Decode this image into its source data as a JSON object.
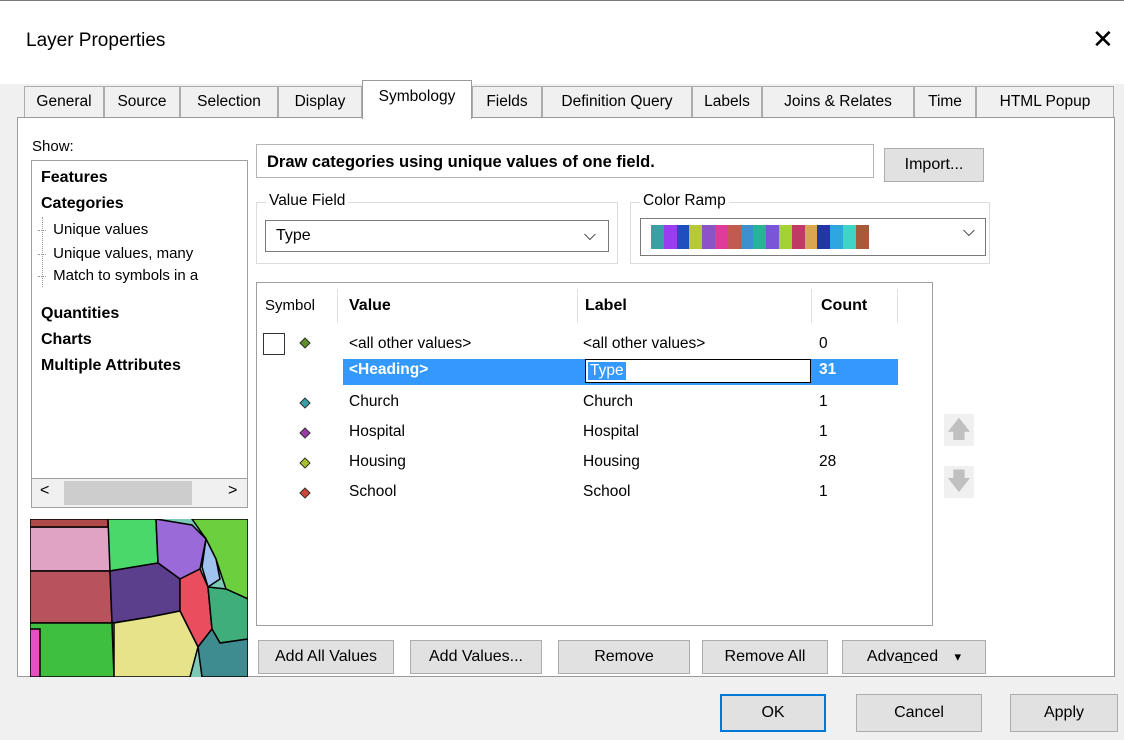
{
  "window": {
    "title": "Layer Properties",
    "close": "✕"
  },
  "tabs": [
    {
      "label": "General",
      "active": false
    },
    {
      "label": "Source",
      "active": false
    },
    {
      "label": "Selection",
      "active": false
    },
    {
      "label": "Display",
      "active": false
    },
    {
      "label": "Symbology",
      "active": true
    },
    {
      "label": "Fields",
      "active": false
    },
    {
      "label": "Definition Query",
      "active": false
    },
    {
      "label": "Labels",
      "active": false
    },
    {
      "label": "Joins & Relates",
      "active": false
    },
    {
      "label": "Time",
      "active": false
    },
    {
      "label": "HTML Popup",
      "active": false
    }
  ],
  "show": {
    "label": "Show:",
    "items": [
      "Features",
      "Categories",
      "Quantities",
      "Charts",
      "Multiple Attributes"
    ],
    "sub_items": [
      "Unique values",
      "Unique values, many",
      "Match to symbols in a"
    ],
    "scroll_left": "<",
    "scroll_right": ">"
  },
  "description": "Draw categories using unique values of one field.",
  "import_button": "Import...",
  "value_field": {
    "label": "Value Field",
    "value": "Type",
    "chevron": "⌵"
  },
  "color_ramp": {
    "label": "Color Ramp",
    "colors": [
      "#3aa0a4",
      "#9a3df0",
      "#1f4fbf",
      "#b7c934",
      "#8d52c8",
      "#e03a9a",
      "#c25a4f",
      "#3e8fcf",
      "#27b399",
      "#7a55d8",
      "#a4d233",
      "#c03b63",
      "#d8a74f",
      "#2137a7",
      "#2ea6e0",
      "#3fd4c6",
      "#a75a3a"
    ]
  },
  "table": {
    "headers": {
      "symbol": "Symbol",
      "value": "Value",
      "label": "Label",
      "count": "Count"
    },
    "rows": [
      {
        "value": "<all other values>",
        "label": "<all other values>",
        "count": "0",
        "color": "#5c8f2a"
      },
      {
        "value": "<Heading>",
        "label": "Type",
        "count": "31",
        "selected": true
      },
      {
        "value": "Church",
        "label": "Church",
        "count": "1",
        "color": "#3aa0a4"
      },
      {
        "value": "Hospital",
        "label": "Hospital",
        "count": "1",
        "color": "#9a3fa5"
      },
      {
        "value": "Housing",
        "label": "Housing",
        "count": "28",
        "color": "#a8bf2e"
      },
      {
        "value": "School",
        "label": "School",
        "count": "1",
        "color": "#d0453a"
      }
    ]
  },
  "side_arrows": {
    "up": "🡅",
    "down": "🡇"
  },
  "table_buttons": {
    "add_all": "Add All Values",
    "add_values": "Add Values...",
    "remove": "Remove",
    "remove_all": "Remove All",
    "advanced_prefix": "Adva",
    "advanced_mnemonic": "n",
    "advanced_suffix": "ced",
    "advanced_caret": "▾"
  },
  "dialog_buttons": {
    "ok": "OK",
    "cancel": "Cancel",
    "apply": "Apply"
  },
  "colors": {
    "selection": "#3399ff",
    "button_face": "#e1e1e1",
    "focus_border": "#0078d7"
  }
}
